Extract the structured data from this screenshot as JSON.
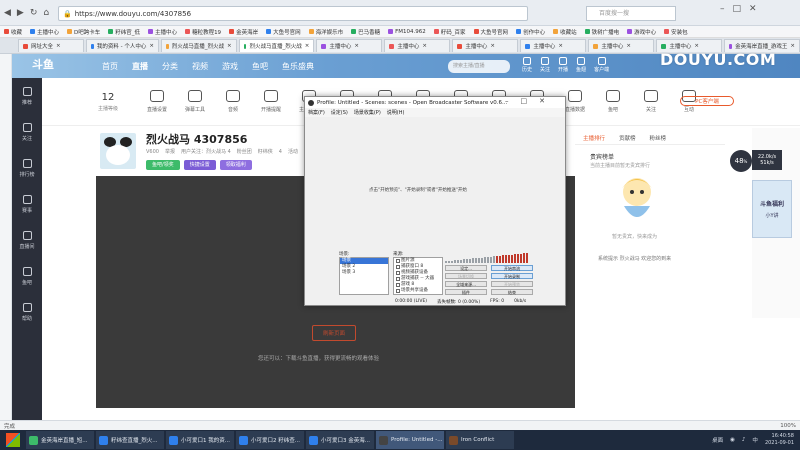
{
  "browser": {
    "url": "https://www.douyu.com/4307856",
    "search_placeholder": "百度搜一搜",
    "bookmarks": [
      "收藏",
      "主播中心",
      "D吧跨卡车",
      "籽纬官_低",
      "主播中心",
      "糖粒教程19",
      "金英海岸",
      "大鱼号官网",
      "海洋娱乐市",
      "巴马香糖",
      "FM104.962",
      "籽码_百家",
      "大鱼号官网",
      "创作中心",
      "收藏站",
      "铁树广播电",
      "游戏中心",
      "安装包"
    ],
    "tabs": [
      "网址大全",
      "我的资料 - 个人中心",
      "烈火战马直播_烈火战",
      "烈火战马直播_烈火战",
      "主播中心",
      "主播中心",
      "主播中心",
      "主播中心",
      "主播中心",
      "主播中心",
      "金英海岸直播_游戏王"
    ],
    "active_tab_index": 3,
    "status_left": "完成",
    "status_zoom": "100%"
  },
  "douyu_header": {
    "logo": "斗鱼",
    "nav": [
      "首页",
      "直播",
      "分类",
      "视频",
      "游戏",
      "鱼吧",
      "鱼乐盛典"
    ],
    "search_placeholder": "搜索主播/直播",
    "icons": [
      "历史",
      "关注",
      "开播",
      "鱼翅",
      "客户端"
    ],
    "watermark": "DOUYU.COM"
  },
  "sidebar": [
    "推荐",
    "关注",
    "排行榜",
    "赛事",
    "直播间",
    "鱼吧",
    "帮助"
  ],
  "toolbar": {
    "level": "12",
    "level_label": "主播等级",
    "items": [
      "直播设置",
      "弹幕工具",
      "音频",
      "开播提醒",
      "主播数据",
      "视频工具",
      "道具工具",
      "商城",
      "主播工具",
      "舞台",
      "大屏",
      "直播数据",
      "鱼吧",
      "关注",
      "互动"
    ],
    "pc_button": "PC客户端"
  },
  "room": {
    "title": "烈火战马 4307856",
    "meta": [
      "举报",
      "用户关注：烈火战马 4",
      "粉丝团"
    ],
    "tags": [
      "籽纬侠",
      "4",
      "活动",
      "50.1kg"
    ],
    "buttons": [
      "鱼吧/领奖",
      "快捷设置",
      "领取福利"
    ],
    "level_badge": "V600"
  },
  "player": {
    "reload_button": "刷新页面",
    "tip": "您还可以：下载斗鱼直播，获得更流畅的观看体验"
  },
  "right_panel": {
    "tabs": [
      "主播排行",
      "贡献榜",
      "粉丝榜"
    ],
    "rank_title": "贵宾榜单",
    "rank_sub": "当前主播目前暂无贵宾排行",
    "mascot_text": "暂无贵宾，快来成为",
    "chat": "系统提示  烈火战马 欢迎您的到来"
  },
  "far_right": {
    "online": "48",
    "online_unit": "%",
    "speed_up": "22.0k/s",
    "speed_down": "51k/s",
    "promo_title": "斗鱼福利",
    "promo_sub": "小Y讲"
  },
  "obs": {
    "title": "Profile: Untitled - Scenes: scenes - Open Broadcaster Software v0.6...",
    "menu": [
      "档案(F)",
      "设定(S)",
      "场景收集(P)",
      "说明(H)",
      "档案集合(C)",
      "帮助(H)"
    ],
    "preview_msg": "点击\"开始预览\"、\"开始录制\"或者\"开始推送\"开始",
    "scenes_label": "场景:",
    "scenes": [
      "场景",
      "场景 2",
      "场景 3"
    ],
    "sources_label": "来源:",
    "sources": [
      "图片源",
      "捕获窗口 8",
      "视频捕获设备",
      "游戏捕获 -- 大器",
      "游戏 8",
      "场景共享设备"
    ],
    "buttons": [
      "设定...",
      "开始串流",
      "场景切换",
      "开始录制",
      "全域来源...",
      "开始预览",
      "插件",
      "结束"
    ],
    "status": [
      "0:00:00 (LIVE)",
      "丢失帧数: 0 (0.00%)",
      "FPS: 0",
      "0kb/s"
    ]
  },
  "taskbar": {
    "items": [
      "金英海岸直播_短...",
      "籽纬查直播_烈火...",
      "小可爱口1 我的资...",
      "小可爱口2 籽纬查...",
      "小可爱口3 金英海...",
      "Profile: Untitled -...",
      "Iron Conflict"
    ],
    "active_index": 5,
    "tray_label": "桌面",
    "time": "16:40:58",
    "date": "2021-09-01"
  }
}
